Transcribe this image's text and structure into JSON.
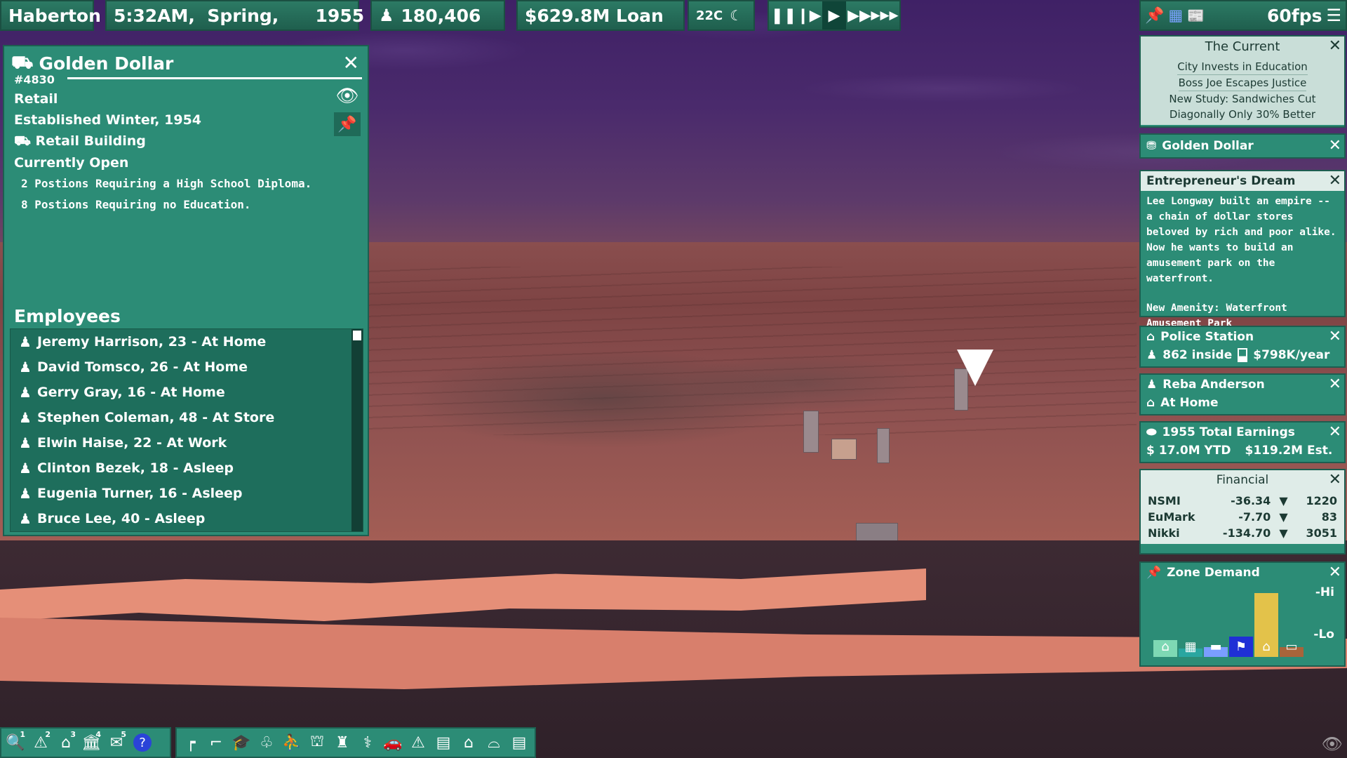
{
  "topbar": {
    "city_name": "Haberton",
    "datetime": "5:32AM,  Spring,      1955",
    "population": "180,406",
    "budget": "$629.8M Loan",
    "weather": "22C",
    "fps": "60fps"
  },
  "detail": {
    "title": "Golden  Dollar",
    "id": "#4830",
    "type": "Retail",
    "established": "Established Winter, 1954",
    "building": "Retail  Building",
    "status": "Currently  Open",
    "positions": [
      "2  Postions  Requiring  a  High  School  Diploma.",
      "8  Postions  Requiring  no  Education."
    ],
    "employees_heading": "Employees",
    "employees": [
      {
        "label": "Jeremy  Harrison,  23  -  At  Home"
      },
      {
        "label": "David  Tomsco,  26  -  At  Home"
      },
      {
        "label": "Gerry  Gray,  16  -  At  Home"
      },
      {
        "label": "Stephen  Coleman,  48  -  At  Store"
      },
      {
        "label": "Elwin  Haise,  22  -  At  Work"
      },
      {
        "label": "Clinton  Bezek,  18  -  Asleep"
      },
      {
        "label": "Eugenia  Turner,  16  -  Asleep"
      },
      {
        "label": "Bruce  Lee,  40  -  Asleep"
      }
    ]
  },
  "news": {
    "title": "The  Current",
    "headlines": [
      "City  Invests  in  Education",
      "Boss  Joe  Escapes  Justice",
      "New  Study:  Sandwiches  Cut",
      "Diagonally  Only  30%  Better"
    ]
  },
  "golden_dollar_panel": {
    "title": "Golden  Dollar"
  },
  "story": {
    "title": "Entrepreneur's  Dream",
    "text": "Lee Longway built an empire -- a chain of dollar stores beloved by rich and poor alike. Now he wants to build an amusement park on the waterfront.",
    "amenity": "New Amenity: Waterfront Amusement Park"
  },
  "police": {
    "title": "Police  Station",
    "inside": "862  inside",
    "budget": "$798K/year"
  },
  "person": {
    "name": "Reba  Anderson",
    "status": "At  Home"
  },
  "earnings": {
    "title": "1955  Total  Earnings",
    "ytd": "$  17.0M  YTD",
    "est": "$119.2M  Est."
  },
  "financial": {
    "title": "Financial",
    "rows": [
      {
        "name": "NSMI",
        "change": "-36.34",
        "value": "1220"
      },
      {
        "name": "EuMark",
        "change": "-7.70",
        "value": "83"
      },
      {
        "name": "Nikki",
        "change": "-134.70",
        "value": "3051"
      }
    ]
  },
  "zone": {
    "title": "Zone  Demand",
    "hi": "-Hi",
    "lo": "-Lo",
    "bars": [
      {
        "name": "residential-low",
        "color": "#7ed8b4",
        "level": 0.25
      },
      {
        "name": "residential-high",
        "color": "#2aa6a0",
        "level": 0.12
      },
      {
        "name": "retail-low",
        "color": "#7a9eff",
        "level": 0.15
      },
      {
        "name": "retail-high",
        "color": "#1f2fd6",
        "level": 0.3
      },
      {
        "name": "industrial-low",
        "color": "#e3c24a",
        "level": 0.95
      },
      {
        "name": "industrial-high",
        "color": "#a8643a",
        "level": 0.15
      }
    ]
  },
  "toolbar": {
    "numbered": [
      "1",
      "2",
      "3",
      "4",
      "5"
    ]
  }
}
